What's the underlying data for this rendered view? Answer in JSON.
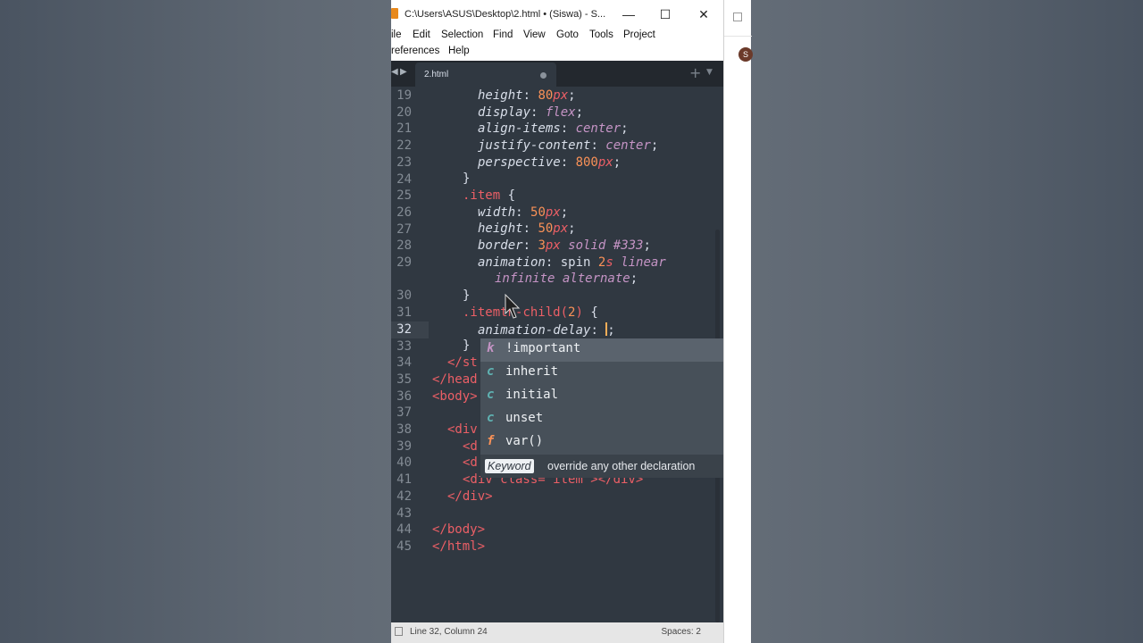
{
  "window": {
    "title": "C:\\Users\\ASUS\\Desktop\\2.html • (Siswa) - S...",
    "minimize": "—",
    "maximize": "☐",
    "close": "✕"
  },
  "menu": {
    "row1": [
      "ile",
      "Edit",
      "Selection",
      "Find",
      "View",
      "Goto",
      "Tools",
      "Project"
    ],
    "row2": [
      "references",
      "Help"
    ]
  },
  "tabs": {
    "nav_left": "◀",
    "nav_right": "▶",
    "active_tab": "2.html",
    "new_tab": "+",
    "tab_menu": "▼"
  },
  "editor": {
    "active_line": 32,
    "line_numbers": [
      "19",
      "20",
      "21",
      "22",
      "23",
      "24",
      "25",
      "26",
      "27",
      "28",
      "29",
      "",
      "30",
      "31",
      "32",
      "33",
      "34",
      "35",
      "36",
      "37",
      "38",
      "39",
      "40",
      "41",
      "42",
      "43",
      "44",
      "45"
    ],
    "code": {
      "l19": {
        "prop": "height",
        "num": "80",
        "unit": "px"
      },
      "l20": {
        "prop": "display",
        "val": "flex"
      },
      "l21": {
        "prop": "align-items",
        "val": "center"
      },
      "l22": {
        "prop": "justify-content",
        "val": "center"
      },
      "l23": {
        "prop": "perspective",
        "num": "800",
        "unit": "px"
      },
      "l24": "}",
      "l25": {
        "sel": ".item",
        "brace": "{"
      },
      "l26": {
        "prop": "width",
        "num": "50",
        "unit": "px"
      },
      "l27": {
        "prop": "height",
        "num": "50",
        "unit": "px"
      },
      "l28": {
        "prop": "border",
        "num": "3",
        "unit": "px",
        "val1": "solid",
        "val2": "#333"
      },
      "l29": {
        "prop": "animation",
        "name": "spin",
        "num": "2",
        "unit": "s",
        "val": "linear"
      },
      "l29b": {
        "val": "infinite alternate"
      },
      "l30": "}",
      "l31": {
        "sel_a": ".item",
        "sel_b": "th-child(",
        "num": "2",
        "sel_c": ")",
        "brace": "{"
      },
      "l32": {
        "prop": "animation-delay"
      },
      "l33": "}",
      "l34": "</st",
      "l35": "</head",
      "l36": "<body>",
      "l38": "<div",
      "l39": "<d",
      "l40": "<d",
      "l41": "<div class=\"item\"></div>",
      "l42": "</div>",
      "l44": "</body>",
      "l45": "</html>"
    }
  },
  "autocomplete": {
    "items": [
      {
        "kind": "k",
        "label": "!important"
      },
      {
        "kind": "c",
        "label": "inherit"
      },
      {
        "kind": "c",
        "label": "initial"
      },
      {
        "kind": "c",
        "label": "unset"
      },
      {
        "kind": "f",
        "label": "var()"
      }
    ],
    "footer_badge": "Keyword",
    "footer_text": "override any other declaration"
  },
  "status": {
    "position": "Line 32, Column 24",
    "spaces": "Spaces: 2"
  },
  "second_window": {
    "avatar_letter": "S"
  }
}
